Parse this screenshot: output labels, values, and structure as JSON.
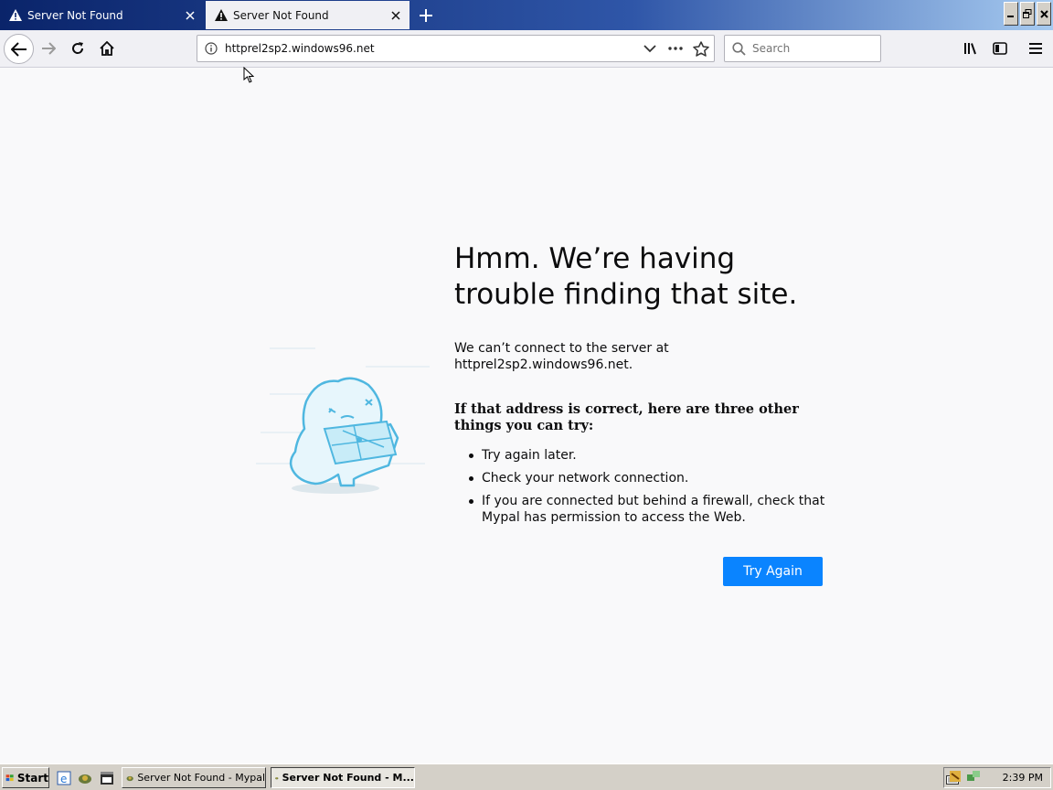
{
  "tabs": [
    {
      "label": "Server Not Found",
      "active": false
    },
    {
      "label": "Server Not Found",
      "active": true
    }
  ],
  "navbar": {
    "url": "httprel2sp2.windows96.net",
    "search_placeholder": "Search"
  },
  "error": {
    "title": "Hmm. We’re having trouble finding that site.",
    "description": "We can’t connect to the server at httprel2sp2.windows96.net.",
    "heading": "If that address is correct, here are three other things you can try:",
    "items": [
      "Try again later.",
      "Check your network connection.",
      "If you are connected but behind a firewall, check that Mypal has permission to access the Web."
    ],
    "button": "Try Again"
  },
  "taskbar": {
    "start_label": "Start",
    "tasks": [
      {
        "label": "Server Not Found - Mypal",
        "active": false
      },
      {
        "label": "Server Not Found - M...",
        "active": true
      }
    ],
    "clock": "2:39 PM"
  },
  "colors": {
    "accent": "#0a84ff",
    "titlebar_start": "#0a246a",
    "titlebar_end": "#a6caf0",
    "illustration": "#4fb7e0"
  }
}
